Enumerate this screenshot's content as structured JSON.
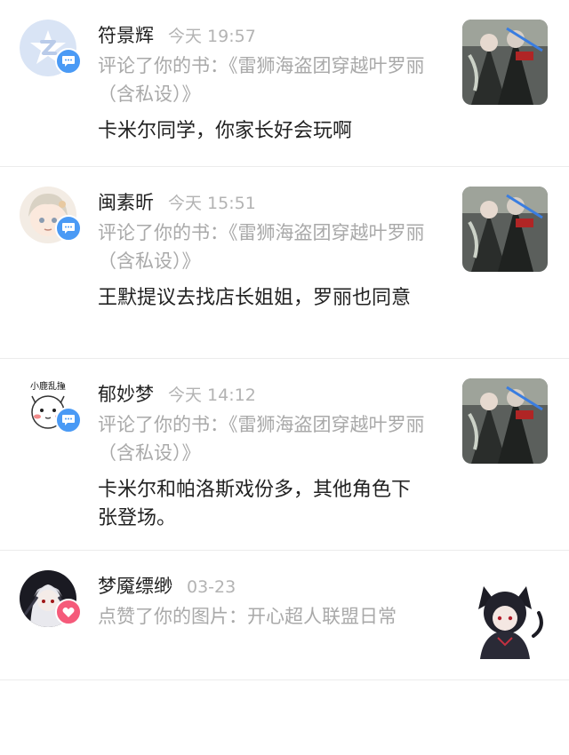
{
  "notifications": [
    {
      "user": "符景辉",
      "time": "今天 19:57",
      "action": "评论了你的书：《雷狮海盗团穿越叶罗丽（含私设）》",
      "comment": "卡米尔同学，你家长好会玩啊",
      "badge": "comment-icon",
      "badge_color": "#4a9af5"
    },
    {
      "user": "闽素昕",
      "time": "今天 15:51",
      "action": "评论了你的书：《雷狮海盗团穿越叶罗丽（含私设）》",
      "comment": "王默提议去找店长姐姐，罗丽也同意",
      "badge": "comment-icon",
      "badge_color": "#4a9af5"
    },
    {
      "user": "郁妙梦",
      "time": "今天 14:12",
      "action": "评论了你的书：《雷狮海盗团穿越叶罗丽（含私设）》",
      "comment": "卡米尔和帕洛斯戏份多，其他角色下张登场。",
      "avatar_text": "小鹿乱撞",
      "badge": "comment-icon",
      "badge_color": "#4a9af5"
    },
    {
      "user": "梦魇缥缈",
      "time": "03-23",
      "action": "点赞了你的图片：开心超人联盟日常",
      "badge": "heart-icon",
      "badge_color": "#f55a7a"
    }
  ]
}
